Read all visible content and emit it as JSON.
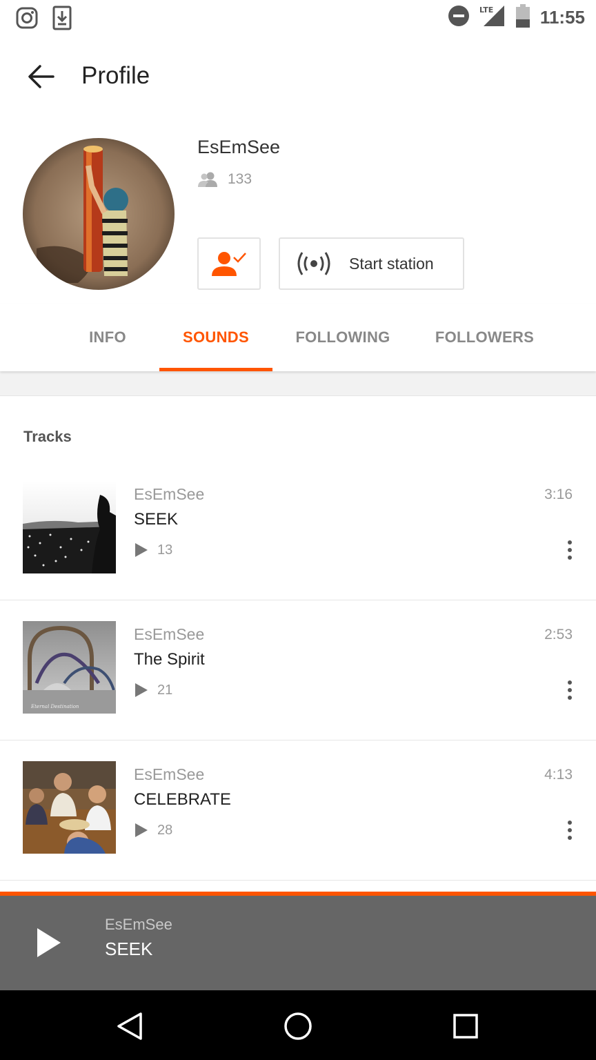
{
  "status_bar": {
    "time": "11:55",
    "network": "LTE",
    "left_icons": [
      "instagram-icon",
      "download-icon"
    ],
    "right_icons": [
      "do-not-disturb-icon",
      "signal-icon",
      "battery-icon"
    ]
  },
  "toolbar": {
    "title": "Profile",
    "back_icon": "arrow-left-icon"
  },
  "profile": {
    "name": "EsEmSee",
    "followers_count": "133",
    "follow_icon": "user-check-icon",
    "station_label": "Start station",
    "station_icon": "radio-broadcast-icon"
  },
  "tabs": [
    {
      "label": "INFO",
      "active": false
    },
    {
      "label": "SOUNDS",
      "active": true
    },
    {
      "label": "FOLLOWING",
      "active": false
    },
    {
      "label": "FOLLOWERS",
      "active": false
    }
  ],
  "section": {
    "title": "Tracks"
  },
  "tracks": [
    {
      "user": "EsEmSee",
      "title": "SEEK",
      "plays": "13",
      "duration": "3:16"
    },
    {
      "user": "EsEmSee",
      "title": "The Spirit",
      "plays": "21",
      "duration": "2:53"
    },
    {
      "user": "EsEmSee",
      "title": "CELEBRATE",
      "plays": "28",
      "duration": "4:13"
    }
  ],
  "player": {
    "user": "EsEmSee",
    "title": "SEEK",
    "play_icon": "play-icon"
  },
  "nav": {
    "icons": [
      "back-triangle-icon",
      "home-circle-icon",
      "recents-square-icon"
    ]
  },
  "colors": {
    "accent": "#ff5500",
    "player_bg": "#666666",
    "nav_bg": "#000000"
  }
}
